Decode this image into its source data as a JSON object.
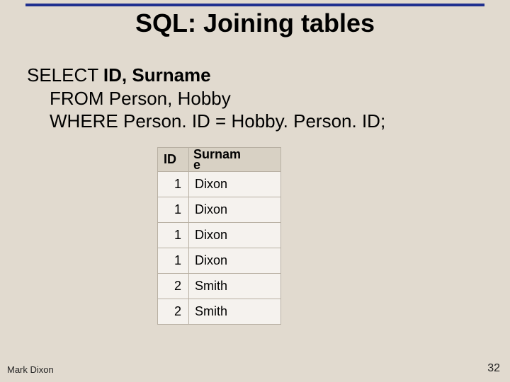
{
  "title": "SQL: Joining tables",
  "sql": {
    "line1_prefix": "SELECT ",
    "line1_bold": "ID, Surname",
    "line2": "FROM Person, Hobby",
    "line3": "WHERE Person. ID = Hobby. Person. ID;"
  },
  "table": {
    "headers": {
      "id": "ID",
      "surname_line1": "Surnam",
      "surname_line2": "e"
    },
    "rows": [
      {
        "id": "1",
        "surname": "Dixon"
      },
      {
        "id": "1",
        "surname": "Dixon"
      },
      {
        "id": "1",
        "surname": "Dixon"
      },
      {
        "id": "1",
        "surname": "Dixon"
      },
      {
        "id": "2",
        "surname": "Smith"
      },
      {
        "id": "2",
        "surname": "Smith"
      }
    ]
  },
  "footer": {
    "author": "Mark Dixon",
    "page": "32"
  }
}
